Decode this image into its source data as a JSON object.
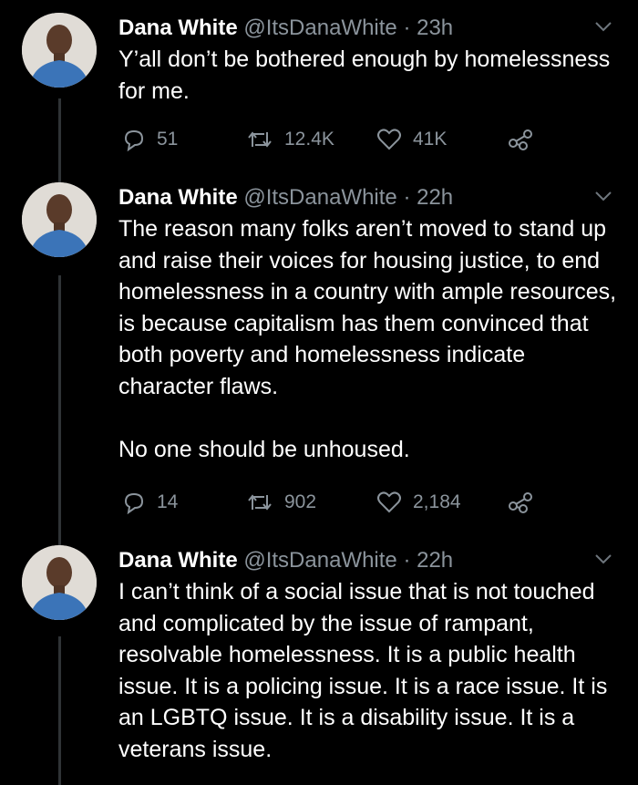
{
  "tweets": [
    {
      "name": "Dana White",
      "handle": "@ItsDanaWhite",
      "time": "· 23h",
      "text": "Y’all don’t be bothered enough by homelessness for me.",
      "replies": "51",
      "retweets": "12.4K",
      "likes": "41K"
    },
    {
      "name": "Dana White",
      "handle": "@ItsDanaWhite",
      "time": "· 22h",
      "text": "The reason many folks aren’t moved to stand up and raise their voices for housing justice, to end homelessness in a country with ample resources, is because capitalism has them convinced that both poverty and homelessness indicate character flaws.\n\nNo one should be unhoused.",
      "replies": "14",
      "retweets": "902",
      "likes": "2,184"
    },
    {
      "name": "Dana White",
      "handle": "@ItsDanaWhite",
      "time": "· 22h",
      "text": "I can’t think of a social issue that is not touched and complicated by the issue of rampant, resolvable homelessness. It is a public health issue. It is a policing issue. It is a race issue. It is an LGBTQ issue. It is a disability issue. It is a veterans issue."
    }
  ],
  "icons": [
    "reply-icon",
    "retweet-icon",
    "like-icon",
    "share-icon",
    "chevron-down-icon"
  ],
  "colors": {
    "background": "#000000",
    "text": "#ffffff",
    "muted": "#8b949c",
    "thread_line": "#2f3336"
  }
}
